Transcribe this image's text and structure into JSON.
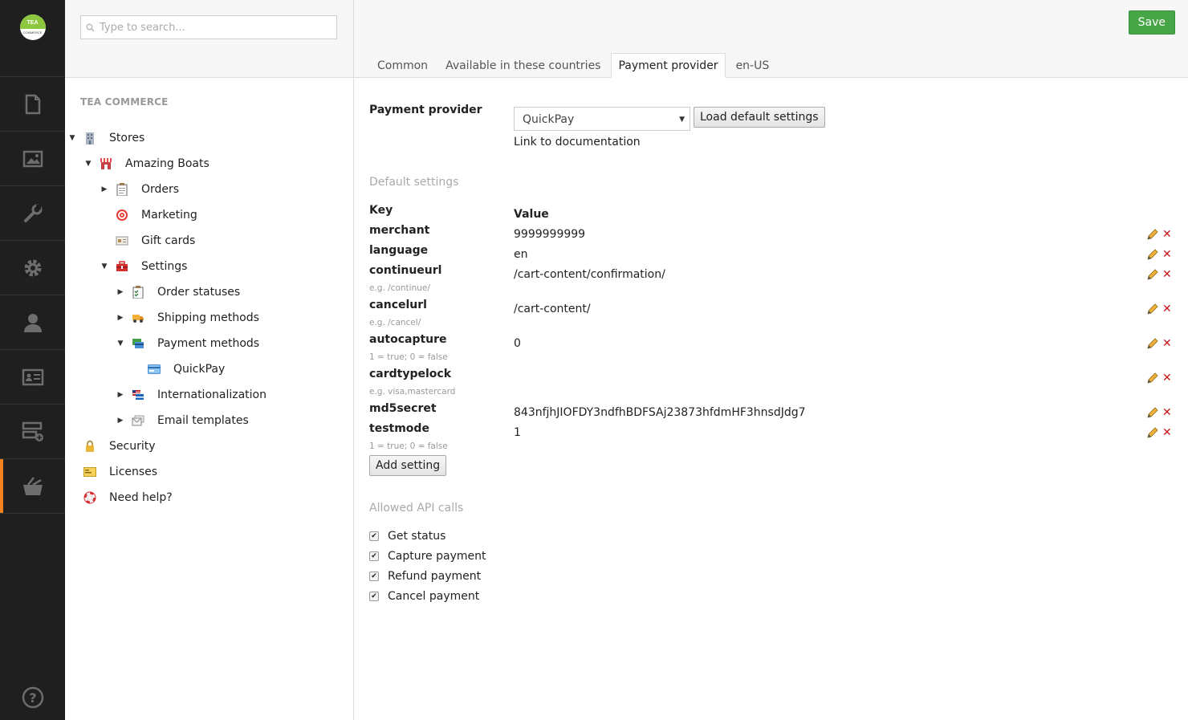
{
  "app": {
    "logo_top": "TEA",
    "logo_bottom": "COMMERCE"
  },
  "appbar": {
    "items": [
      "content-icon",
      "media-icon",
      "developer-icon",
      "settings-icon",
      "users-icon",
      "members-icon",
      "forms-icon",
      "tea-commerce-icon"
    ],
    "active_item": "tea-commerce-icon",
    "accent_color": "#f5821f",
    "help_icon": "help-icon"
  },
  "search": {
    "placeholder": "Type to search..."
  },
  "tree": {
    "section_title": "TEA COMMERCE",
    "nodes": [
      {
        "label": "Stores",
        "icon": "building-icon"
      },
      {
        "label": "Amazing Boats",
        "icon": "store-icon"
      },
      {
        "label": "Orders",
        "icon": "clipboard-icon"
      },
      {
        "label": "Marketing",
        "icon": "target-icon"
      },
      {
        "label": "Gift cards",
        "icon": "gift-card-icon"
      },
      {
        "label": "Settings",
        "icon": "toolbox-icon"
      },
      {
        "label": "Order statuses",
        "icon": "checklist-icon"
      },
      {
        "label": "Shipping methods",
        "icon": "truck-icon"
      },
      {
        "label": "Payment methods",
        "icon": "payment-icon"
      },
      {
        "label": "QuickPay",
        "icon": "credit-card-icon"
      },
      {
        "label": "Internationalization",
        "icon": "flag-icon"
      },
      {
        "label": "Email templates",
        "icon": "email-icon"
      },
      {
        "label": "Security",
        "icon": "lock-icon"
      },
      {
        "label": "Licenses",
        "icon": "license-icon"
      },
      {
        "label": "Need help?",
        "icon": "lifebuoy-icon"
      }
    ]
  },
  "header": {
    "save_label": "Save",
    "save_color": "#46a546",
    "tabs": [
      "Common",
      "Available in these countries",
      "Payment provider",
      "en-US"
    ],
    "active_tab": "Payment provider"
  },
  "provider": {
    "label": "Payment provider",
    "selected": "QuickPay",
    "load_defaults_label": "Load default settings",
    "doc_link": "Link to documentation"
  },
  "defaults": {
    "section_title": "Default settings",
    "key_header": "Key",
    "value_header": "Value",
    "rows": [
      {
        "key": "merchant",
        "value": "9999999999",
        "hint": ""
      },
      {
        "key": "language",
        "value": "en",
        "hint": ""
      },
      {
        "key": "continueurl",
        "value": "/cart-content/confirmation/",
        "hint": "e.g. /continue/"
      },
      {
        "key": "cancelurl",
        "value": "/cart-content/",
        "hint": "e.g. /cancel/"
      },
      {
        "key": "autocapture",
        "value": "0",
        "hint": "1 = true; 0 = false"
      },
      {
        "key": "cardtypelock",
        "value": "",
        "hint": "e.g. visa,mastercard"
      },
      {
        "key": "md5secret",
        "value": "843nfjhJIOFDY3ndfhBDFSAj23873hfdmHF3hnsdJdg7",
        "hint": ""
      },
      {
        "key": "testmode",
        "value": "1",
        "hint": "1 = true; 0 = false"
      }
    ],
    "add_label": "Add setting"
  },
  "api": {
    "section_title": "Allowed API calls",
    "calls": [
      {
        "label": "Get status",
        "checked": true
      },
      {
        "label": "Capture payment",
        "checked": true
      },
      {
        "label": "Refund payment",
        "checked": true
      },
      {
        "label": "Cancel payment",
        "checked": true
      }
    ]
  }
}
